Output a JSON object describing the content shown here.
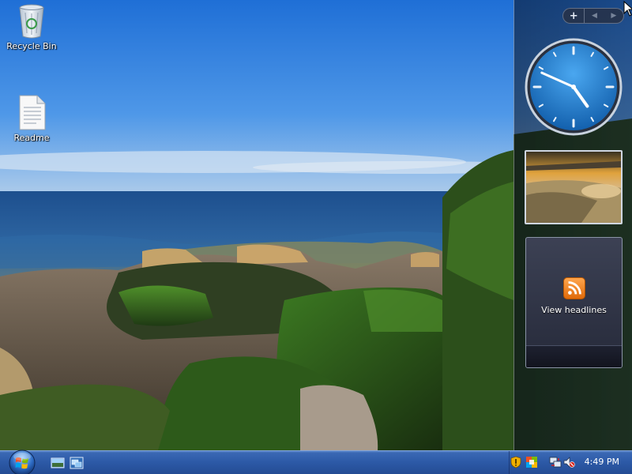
{
  "desktop": {
    "icons": [
      {
        "label": "Recycle Bin",
        "icon": "recycle-bin-icon"
      },
      {
        "label": "Readme",
        "icon": "text-document-icon"
      }
    ],
    "wallpaper": "coastal rocks with green moss beside the sea under a blue sky"
  },
  "sidebar": {
    "toolbar": {
      "add_glyph": "+",
      "prev_glyph": "◀",
      "next_glyph": "▶"
    },
    "clock": {
      "hour": 4,
      "minute": 49,
      "face_color": "#1b73c4"
    },
    "slideshow": {
      "subject": "beach at sunset"
    },
    "feed": {
      "label": "View headlines",
      "icon": "rss-feed-icon"
    }
  },
  "taskbar": {
    "start_icon": "windows-logo-icon",
    "quick_launch": [
      "show-desktop-icon",
      "switch-windows-icon"
    ],
    "tray_icons": [
      "security-shield-icon",
      "security-center-icon",
      "network-icon",
      "volume-muted-icon"
    ],
    "clock": "4:49 PM",
    "colors": {
      "bar_top": "#3a68b4",
      "bar_bottom": "#244c94"
    }
  }
}
